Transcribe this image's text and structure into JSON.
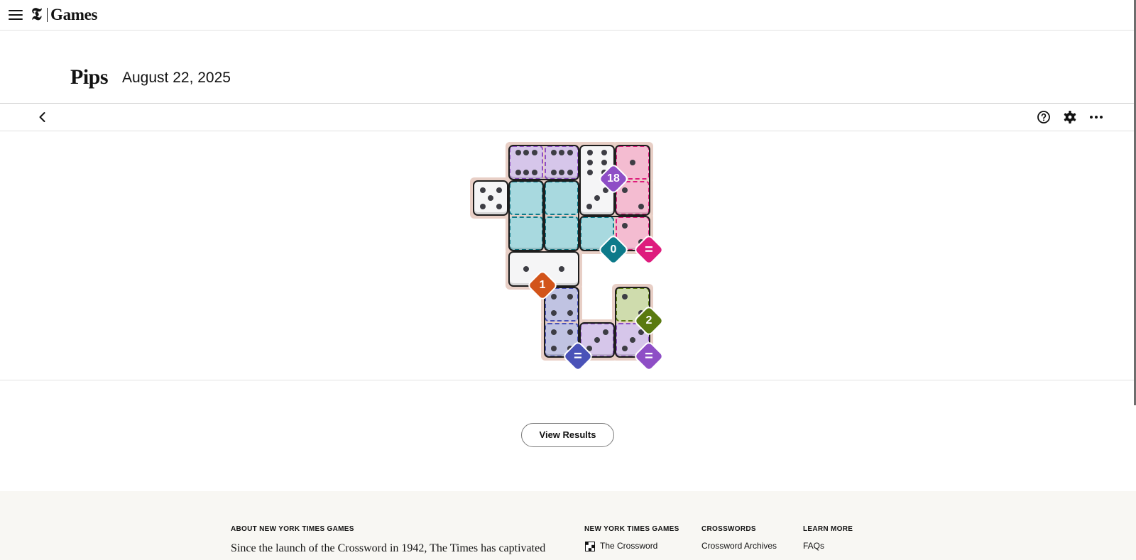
{
  "header": {
    "menu_icon": "hamburger-icon",
    "logo_mark": "𝕿",
    "logo_text": "Games"
  },
  "game": {
    "title": "Pips",
    "date": "August 22, 2025"
  },
  "toolbar": {
    "back_icon": "chevron-left-icon",
    "help_icon": "help-circle-icon",
    "settings_icon": "gear-icon",
    "more_icon": "more-horizontal-icon"
  },
  "board": {
    "regions": [
      {
        "name": "sum-18",
        "label": "18",
        "color": "#8e4ec6",
        "fill": "#d6c6ea"
      },
      {
        "name": "equal-pink",
        "label": "=",
        "color": "#de1c7d",
        "fill": "#f4bcd1"
      },
      {
        "name": "sum-0",
        "label": "0",
        "color": "#0d7a8a",
        "fill": "#a8d9df"
      },
      {
        "name": "sum-1",
        "label": "1",
        "color": "#d2541a",
        "fill": "#f9d8ae"
      },
      {
        "name": "equal-blue",
        "label": "=",
        "color": "#4a52b8",
        "fill": "#c0c3e2"
      },
      {
        "name": "sum-2",
        "label": "2",
        "color": "#5a7a10",
        "fill": "#cfdcad"
      },
      {
        "name": "equal-purple",
        "label": "=",
        "color": "#8e4ec6",
        "fill": "#d6c6ea"
      }
    ],
    "pip_values": {
      "r0": [
        6,
        6,
        6,
        1
      ],
      "r1": [
        5,
        null,
        null,
        3,
        2
      ],
      "r2": [
        null,
        null,
        0,
        2
      ],
      "r3": [
        1,
        1
      ],
      "r4": [
        4,
        2
      ],
      "r5": [
        4,
        3,
        3
      ]
    }
  },
  "actions": {
    "view_results": "View Results"
  },
  "footer": {
    "about_heading": "ABOUT NEW YORK TIMES GAMES",
    "about_text": "Since the launch of the Crossword in 1942, The Times has captivated",
    "col1_heading": "NEW YORK TIMES GAMES",
    "col1_link": "The Crossword",
    "col1_icon": "crossword-grid-icon",
    "col2_heading": "CROSSWORDS",
    "col2_link": "Crossword Archives",
    "col3_heading": "LEARN MORE",
    "col3_link": "FAQs"
  }
}
